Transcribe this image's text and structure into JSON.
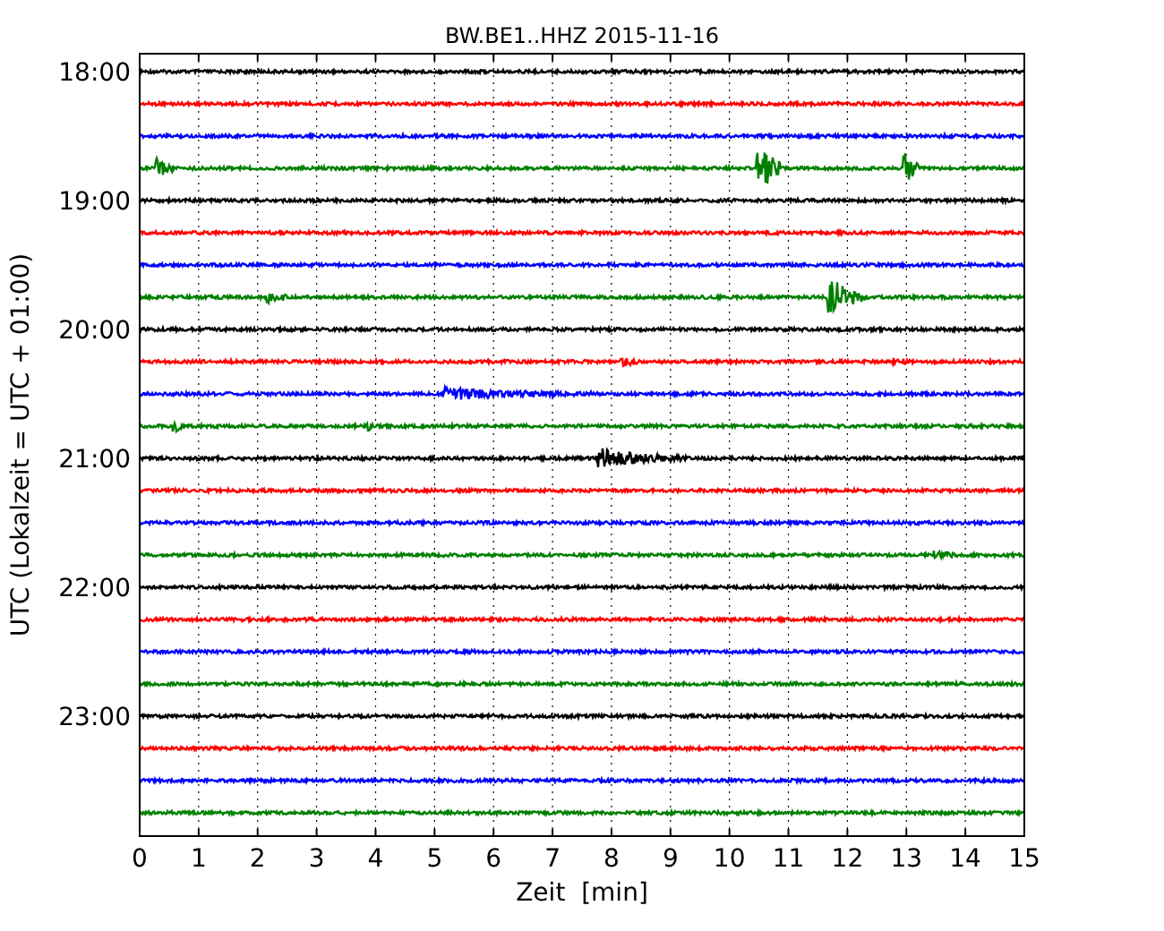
{
  "title": "BW.BE1..HHZ 2015-11-16",
  "xlabel": "Zeit  [min]",
  "ylabel": "UTC (Lokalzeit = UTC + 01:00)",
  "xticks": [
    "0",
    "1",
    "2",
    "3",
    "4",
    "5",
    "6",
    "7",
    "8",
    "9",
    "10",
    "11",
    "12",
    "13",
    "14",
    "15"
  ],
  "yticks": [
    "18:00",
    "19:00",
    "20:00",
    "21:00",
    "22:00",
    "23:00"
  ],
  "traces": [
    {
      "color": "#000000"
    },
    {
      "color": "#ff0000"
    },
    {
      "color": "#0000ff"
    },
    {
      "color": "#008000"
    },
    {
      "color": "#000000"
    },
    {
      "color": "#ff0000"
    },
    {
      "color": "#0000ff"
    },
    {
      "color": "#008000"
    },
    {
      "color": "#000000"
    },
    {
      "color": "#ff0000"
    },
    {
      "color": "#0000ff"
    },
    {
      "color": "#008000"
    },
    {
      "color": "#000000"
    },
    {
      "color": "#ff0000"
    },
    {
      "color": "#0000ff"
    },
    {
      "color": "#008000"
    },
    {
      "color": "#000000"
    },
    {
      "color": "#ff0000"
    },
    {
      "color": "#0000ff"
    },
    {
      "color": "#008000"
    },
    {
      "color": "#000000"
    },
    {
      "color": "#ff0000"
    },
    {
      "color": "#0000ff"
    },
    {
      "color": "#008000"
    }
  ]
}
